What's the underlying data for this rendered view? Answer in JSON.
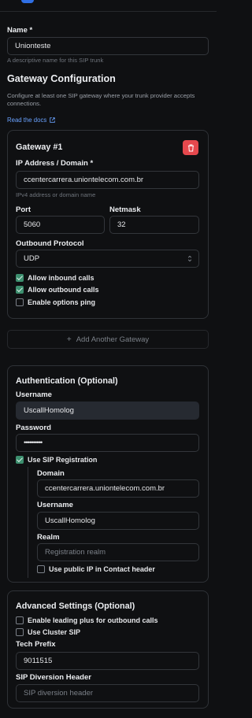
{
  "name": {
    "label": "Name *",
    "value": "Unionteste",
    "hint": "A descriptive name for this SIP trunk"
  },
  "gateway_config": {
    "title": "Gateway Configuration",
    "description": "Configure at least one SIP gateway where your trunk provider accepts connections.",
    "docs_link": "Read the docs"
  },
  "gateway": {
    "title": "Gateway #1",
    "ip_label": "IP Address / Domain *",
    "ip_value": "ccentercarrera.uniontelecom.com.br",
    "ip_hint": "IPv4 address or domain name",
    "port_label": "Port",
    "port_value": "5060",
    "netmask_label": "Netmask",
    "netmask_value": "32",
    "protocol_label": "Outbound Protocol",
    "protocol_value": "UDP",
    "allow_inbound": "Allow inbound calls",
    "allow_outbound": "Allow outbound calls",
    "options_ping": "Enable options ping"
  },
  "add_gateway": "Add Another Gateway",
  "auth": {
    "title": "Authentication (Optional)",
    "username_label": "Username",
    "username_value": "UscallHomolog",
    "password_label": "Password",
    "password_value": "••••••••••",
    "use_sip_registration": "Use SIP Registration",
    "domain_label": "Domain",
    "domain_value": "ccentercarrera.uniontelecom.com.br",
    "reg_username_label": "Username",
    "reg_username_value": "UscallHomolog",
    "realm_label": "Realm",
    "realm_placeholder": "Registration realm",
    "public_ip": "Use public IP in Contact header"
  },
  "advanced": {
    "title": "Advanced Settings (Optional)",
    "leading_plus": "Enable leading plus for outbound calls",
    "cluster_sip": "Use Cluster SIP",
    "tech_prefix_label": "Tech Prefix",
    "tech_prefix_value": "9011515",
    "diversion_label": "SIP Diversion Header",
    "diversion_placeholder": "SIP diversion header"
  },
  "colors": {
    "accent": "#2f6fe4",
    "danger": "#e5484d",
    "check": "#3d8f6f",
    "link": "#6aa2ff"
  }
}
